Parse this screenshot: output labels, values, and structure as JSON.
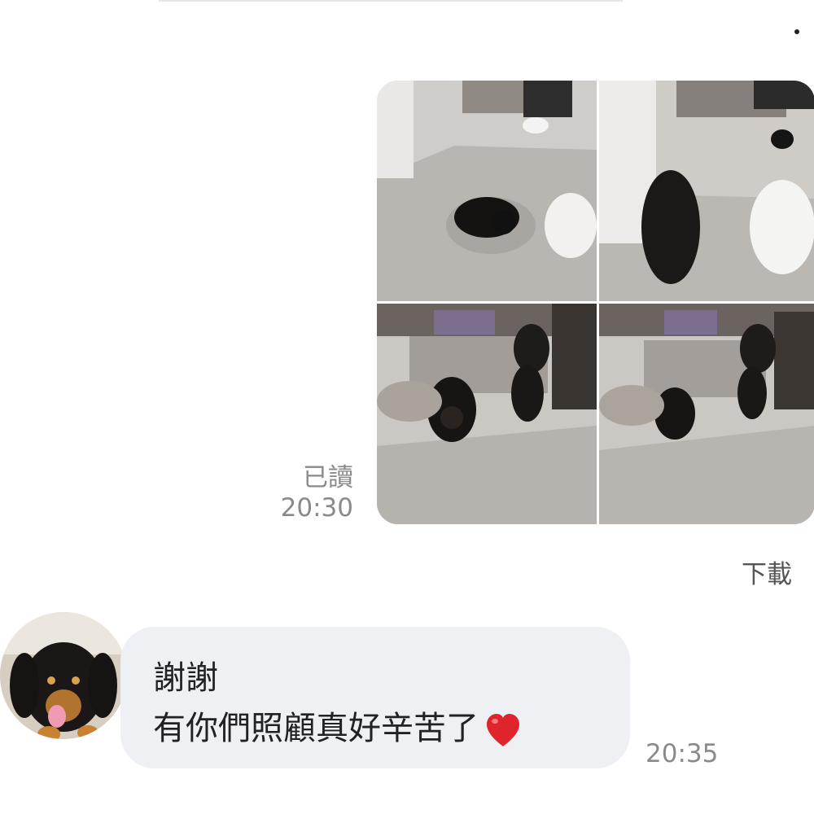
{
  "message_photos": {
    "items": [
      {
        "label": "photo-1"
      },
      {
        "label": "photo-2"
      },
      {
        "label": "photo-3"
      },
      {
        "label": "photo-4"
      }
    ],
    "read_status": "已讀",
    "time": "20:30",
    "download_label": "下載"
  },
  "reply": {
    "line1": "謝謝",
    "line2": "有你們照顧真好辛苦了",
    "emoji": "heart-emoji",
    "time": "20:35"
  },
  "colors": {
    "bubble": "#eef0f3",
    "meta_text": "#8a8a8a",
    "heart": "#e0242b"
  }
}
